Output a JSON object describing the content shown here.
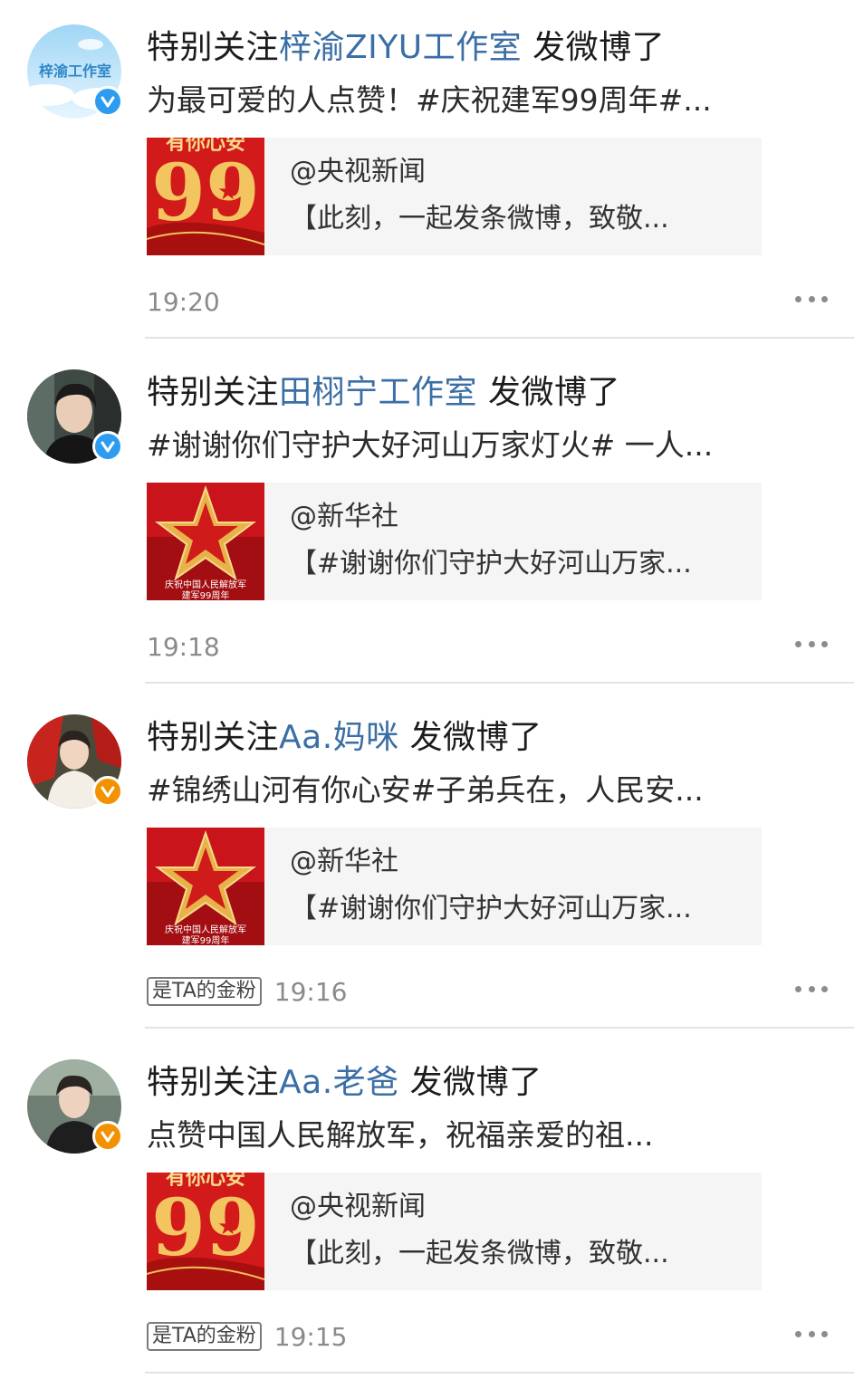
{
  "notifications": [
    {
      "prefix": "特别关注",
      "name": "梓渝ZIYU工作室",
      "suffix": " 发微博了",
      "excerpt": "为最可爱的人点赞！#庆祝建军99周年#...",
      "card_source": "@央视新闻",
      "card_text": "【此刻，一起发条微博，致敬...",
      "time": "19:20",
      "fan_tag": "",
      "avatar_text": "梓渝工作室",
      "thumb": "cctv-99-image",
      "badge_color": "#2d9cf0"
    },
    {
      "prefix": "特别关注",
      "name": "田栩宁工作室",
      "suffix": " 发微博了",
      "excerpt": "#谢谢你们守护大好河山万家灯火# 一人...",
      "card_source": "@新华社",
      "card_text": "【#谢谢你们守护大好河山万家...",
      "time": "19:18",
      "fan_tag": "",
      "thumb": "xinhua-star-image",
      "thumb_caption_1": "庆祝中国人民解放军",
      "thumb_caption_2": "建军99周年",
      "badge_color": "#2d9cf0"
    },
    {
      "prefix": "特别关注",
      "name": "Aa.妈咪",
      "suffix": " 发微博了",
      "excerpt": "#锦绣山河有你心安#子弟兵在，人民安...",
      "card_source": "@新华社",
      "card_text": "【#谢谢你们守护大好河山万家...",
      "time": "19:16",
      "fan_tag": "是TA的金粉",
      "thumb": "xinhua-star-image",
      "thumb_caption_1": "庆祝中国人民解放军",
      "thumb_caption_2": "建军99周年",
      "badge_color": "#f39200"
    },
    {
      "prefix": "特别关注",
      "name": "Aa.老爸",
      "suffix": " 发微博了",
      "excerpt": "点赞中国人民解放军，祝福亲爱的祖...",
      "card_source": "@央视新闻",
      "card_text": "【此刻，一起发条微博，致敬...",
      "time": "19:15",
      "fan_tag": "是TA的金粉",
      "thumb": "cctv-99-image",
      "badge_color": "#f39200"
    }
  ],
  "thumb_big_text": "99",
  "thumb_top_text": "有你心安"
}
